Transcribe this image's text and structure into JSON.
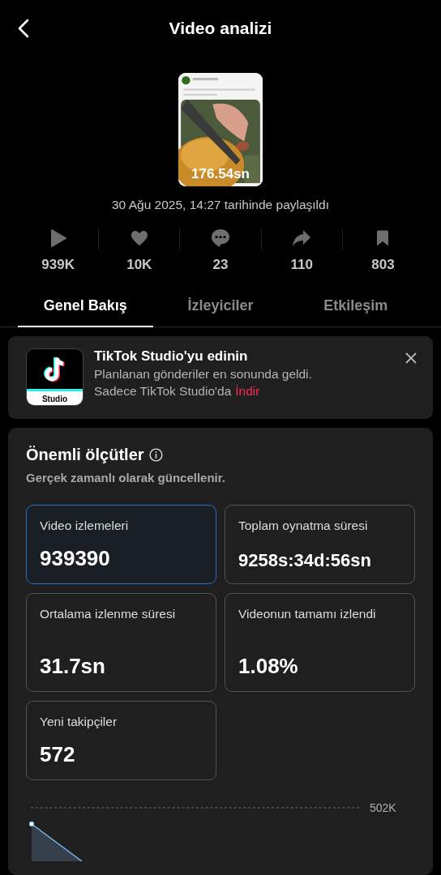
{
  "header": {
    "title": "Video analizi"
  },
  "video": {
    "duration": "176.54sn",
    "posted": "30 Ağu 2025, 14:27 tarihinde paylaşıldı"
  },
  "stats": [
    {
      "kind": "play",
      "value": "939K"
    },
    {
      "kind": "like",
      "value": "10K"
    },
    {
      "kind": "comment",
      "value": "23"
    },
    {
      "kind": "share",
      "value": "110"
    },
    {
      "kind": "save",
      "value": "803"
    }
  ],
  "tabs": [
    {
      "label": "Genel Bakış",
      "selected": true
    },
    {
      "label": "İzleyiciler",
      "selected": false
    },
    {
      "label": "Etkileşim",
      "selected": false
    }
  ],
  "promo": {
    "logo_label": "Studio",
    "title": "TikTok Studio'yu edinin",
    "line1": "Planlanan gönderiler en sonunda geldi.",
    "line2": "Sadece TikTok Studio'da",
    "link": "İndir"
  },
  "metrics": {
    "title": "Önemli ölçütler",
    "subtitle": "Gerçek zamanlı olarak güncellenir.",
    "tiles": [
      {
        "label": "Video izlemeleri",
        "value": "939390",
        "selected": true
      },
      {
        "label": "Toplam oynatma süresi",
        "value": "9258s:34d:56sn",
        "selected": false
      },
      {
        "label": "Ortalama izlenme süresi",
        "value": "31.7sn",
        "selected": false
      },
      {
        "label": "Videonun tamamı izlendi",
        "value": "1.08%",
        "selected": false
      },
      {
        "label": "Yeni takipçiler",
        "value": "572",
        "selected": false
      }
    ],
    "chart_tick": "502K"
  }
}
